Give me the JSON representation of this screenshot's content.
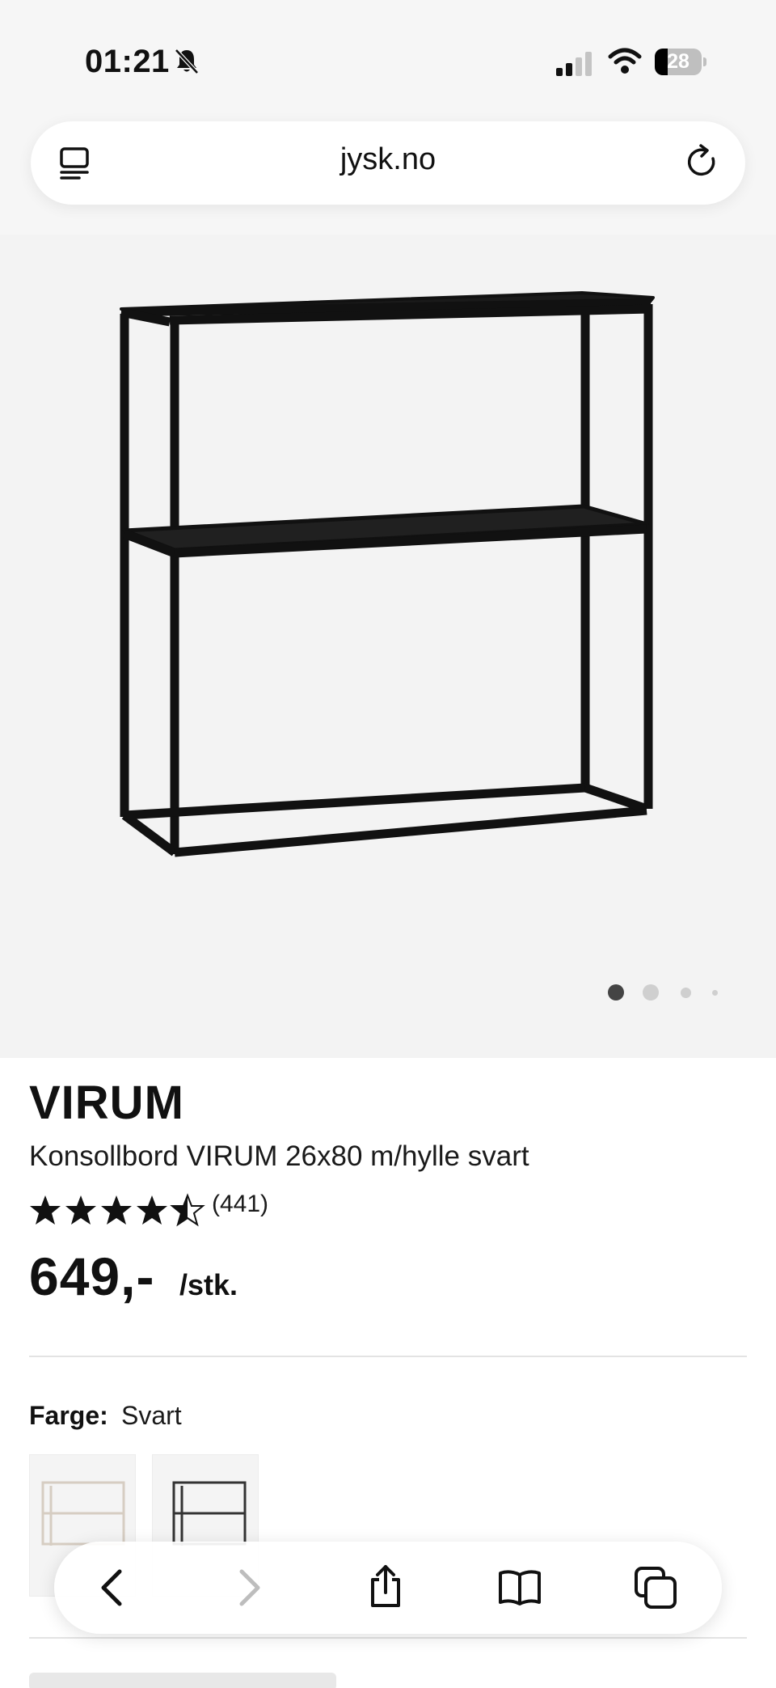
{
  "status_bar": {
    "time": "01:21",
    "battery_level": "28",
    "battery_fraction": 0.28,
    "icons": [
      "bell-slash-icon",
      "cellular-signal-icon",
      "wifi-icon",
      "battery-icon"
    ]
  },
  "browser": {
    "url": "jysk.no",
    "icons": [
      "reader-mode-icon",
      "reload-icon"
    ]
  },
  "gallery": {
    "image_name": "console-table-black-frame-image",
    "slide_count": 4,
    "active_slide": 1
  },
  "product": {
    "brand": "VIRUM",
    "name": "Konsollbord VIRUM 26x80 m/hylle svart",
    "rating_stars": 4.5,
    "rating_count": "(441)",
    "price": "649,-",
    "unit": "/stk."
  },
  "color_selector": {
    "label": "Farge:",
    "value": "Svart",
    "swatches": [
      {
        "name": "white-variant",
        "color": "#d9d2c9"
      },
      {
        "name": "black-variant",
        "color": "#333333"
      }
    ]
  },
  "toolbar": {
    "icons": [
      "back-icon",
      "forward-icon",
      "share-icon",
      "bookmarks-icon",
      "tabs-icon"
    ]
  },
  "colors": {
    "text": "#111111",
    "gallery_bg": "#f3f3f3",
    "divider": "#e3e3e3",
    "ios_blue_inactive": "#bdbdbd"
  }
}
